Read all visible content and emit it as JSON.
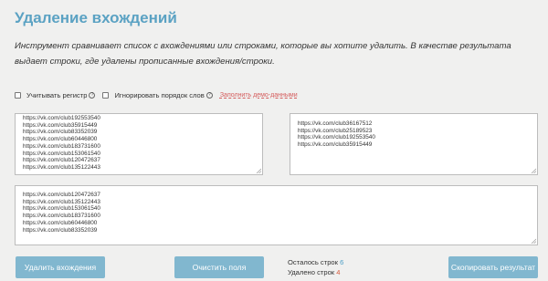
{
  "page": {
    "title": "Удаление вхождений",
    "description": "Инструмент сравнивает список с вхождениями или строками, которые вы хотите удалить. В качестве результата выдает строки, где удалены прописанные вхождения/строки."
  },
  "options": {
    "case_label": "Учитывать регистр",
    "order_label": "Игнорировать порядок слов",
    "help_glyph": "?",
    "demo_link": "Заполнить демо-данными"
  },
  "input_box": {
    "lines": [
      "https://vk.com/club192553540",
      "https://vk.com/club35915449",
      "https://vk.com/club83352039",
      "https://vk.com/club60446800",
      "https://vk.com/club183731600",
      "https://vk.com/club153061540",
      "https://vk.com/club120472637",
      "https://vk.com/club135122443"
    ]
  },
  "remove_box": {
    "lines": [
      "https://vk.com/club36167512",
      "https://vk.com/club25189523",
      "https://vk.com/club192553540",
      "https://vk.com/club35915449"
    ]
  },
  "result_box": {
    "lines": [
      "https://vk.com/club120472637",
      "https://vk.com/club135122443",
      "https://vk.com/club153061540",
      "https://vk.com/club183731600",
      "https://vk.com/club60446800",
      "https://vk.com/club83352039"
    ]
  },
  "buttons": {
    "remove": "Удалить вхождения",
    "clear": "Очистить поля",
    "copy": "Скопировать результат"
  },
  "status": {
    "remaining_label": "Осталось строк",
    "remaining_value": "6",
    "deleted_label": "Удалено строк",
    "deleted_value": "4"
  },
  "colors": {
    "accent": "#5ba2c3",
    "button": "#81b7cf",
    "link": "#d45c5c",
    "remaining": "#4c9ec6",
    "deleted": "#d65a3c"
  },
  "icons": [
    "help-icon",
    "resize-grip-icon",
    "checkbox-icon"
  ]
}
